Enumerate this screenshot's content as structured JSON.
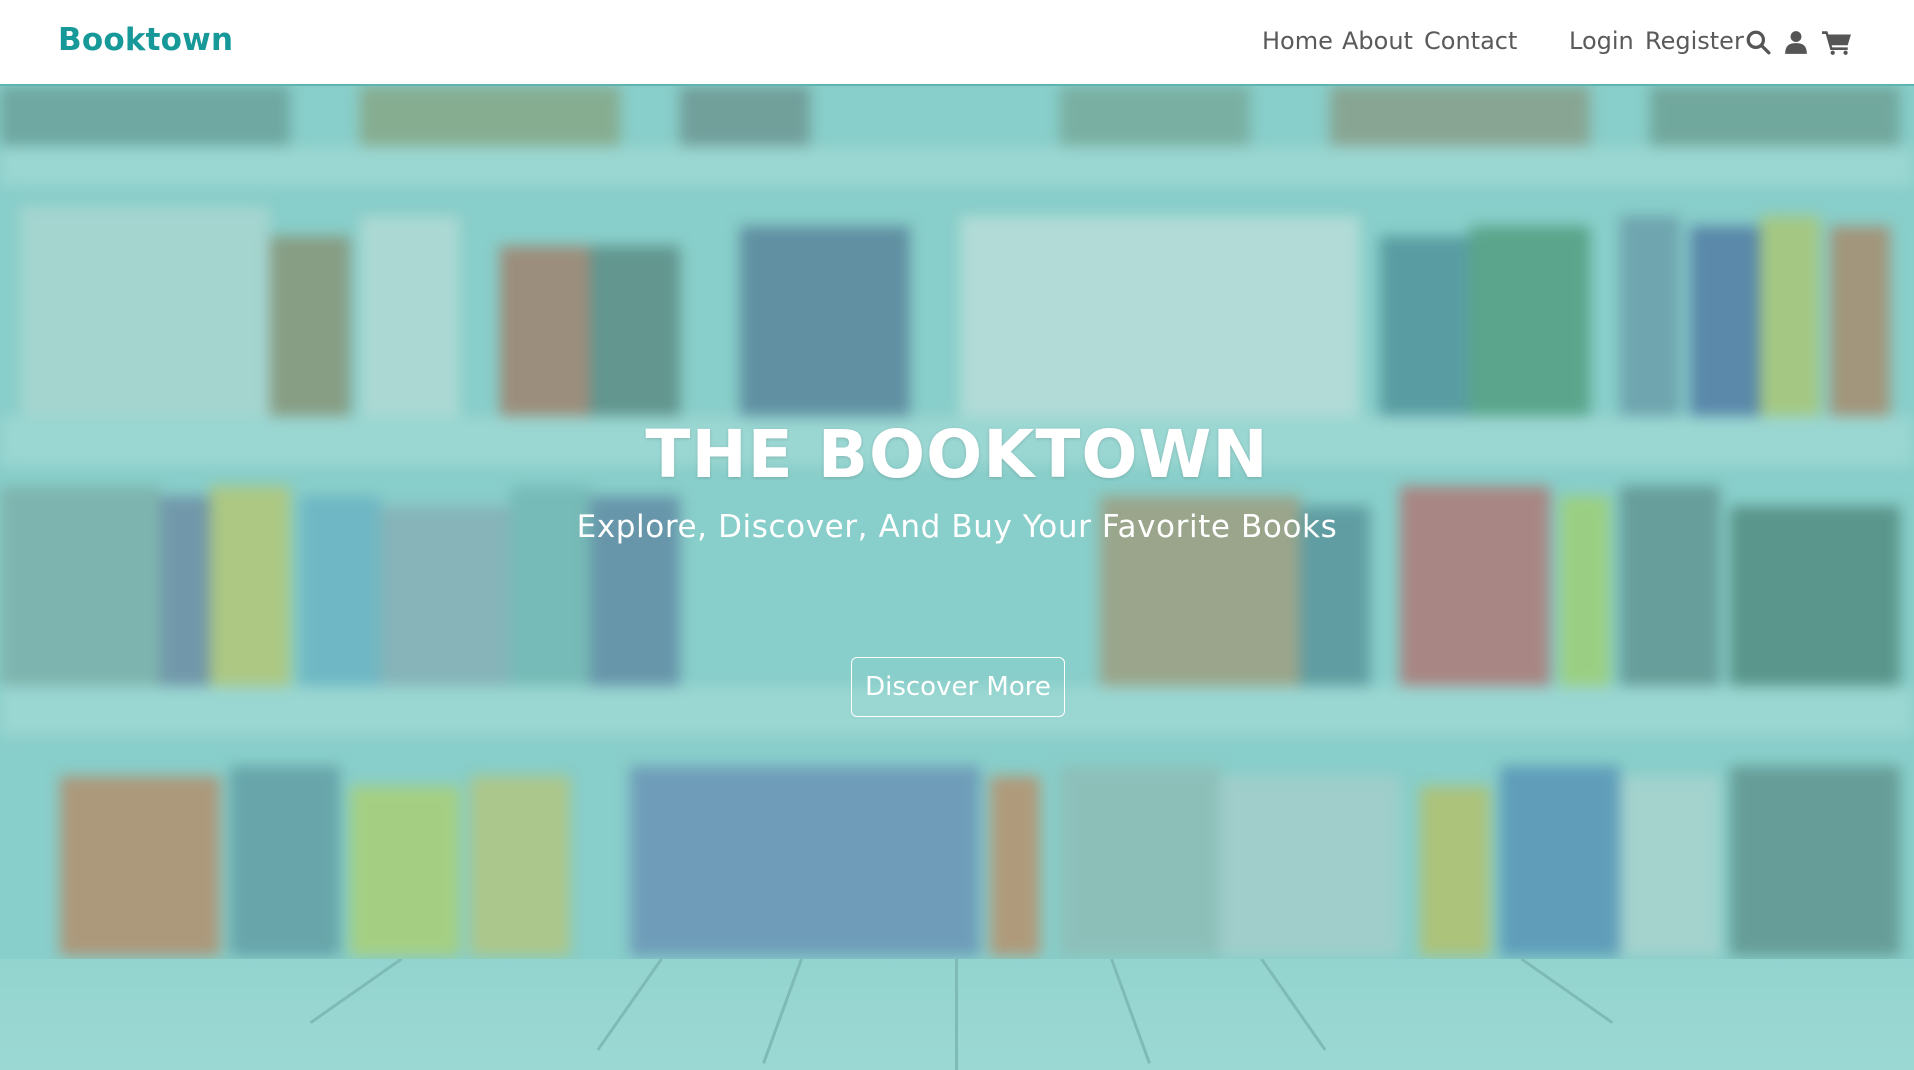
{
  "navbar": {
    "brand": "Booktown",
    "links": [
      "Home",
      "About",
      "Contact"
    ],
    "auth": [
      "Login",
      "Register"
    ],
    "icons": [
      "search-icon",
      "user-icon",
      "cart-icon"
    ]
  },
  "hero": {
    "title": "THE BOOKTOWN",
    "subtitle": "Explore, Discover, And Buy Your Favorite Books",
    "button_label": "Discover More"
  },
  "colors": {
    "brand": "#17999a",
    "nav_text": "#5a5a5a",
    "hero_tint": "#82cdc8",
    "hero_text": "#ffffff"
  }
}
